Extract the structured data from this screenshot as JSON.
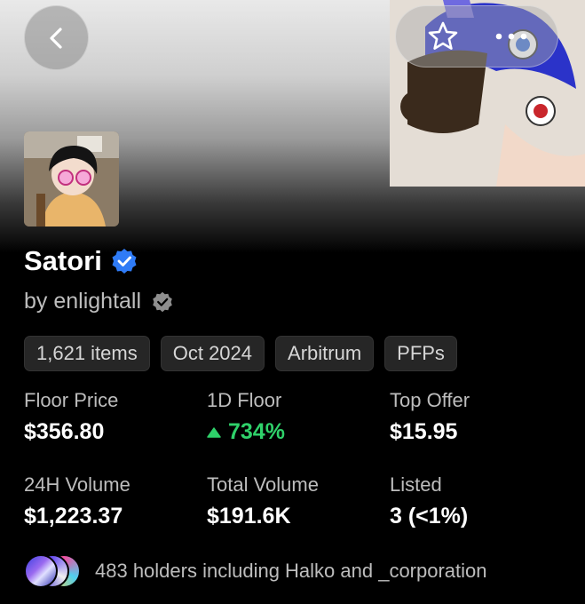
{
  "header": {
    "back_icon": "chevron-left-icon",
    "favorite_icon": "star-icon",
    "more_icon": "more-horizontal-icon"
  },
  "collection": {
    "name": "Satori",
    "verified_icon": "verified-badge-icon",
    "creator": "by enlightall",
    "creator_badge_icon": "verified-badge-icon"
  },
  "tags": [
    "1,621 items",
    "Oct 2024",
    "Arbitrum",
    "PFPs"
  ],
  "stats": [
    {
      "label": "Floor Price",
      "value": "$356.80"
    },
    {
      "label": "1D Floor",
      "value": "734%",
      "trend": "up"
    },
    {
      "label": "Top Offer",
      "value": "$15.95"
    },
    {
      "label": "24H Volume",
      "value": "$1,223.37"
    },
    {
      "label": "Total Volume",
      "value": "$191.6K"
    },
    {
      "label": "Listed",
      "value": "3 (<1%)"
    }
  ],
  "holders": {
    "text": "483 holders including Halko and _corporation"
  },
  "colors": {
    "accent_verified": "#2f7bf6",
    "positive": "#2fd16a",
    "tag_bg": "#262626"
  }
}
